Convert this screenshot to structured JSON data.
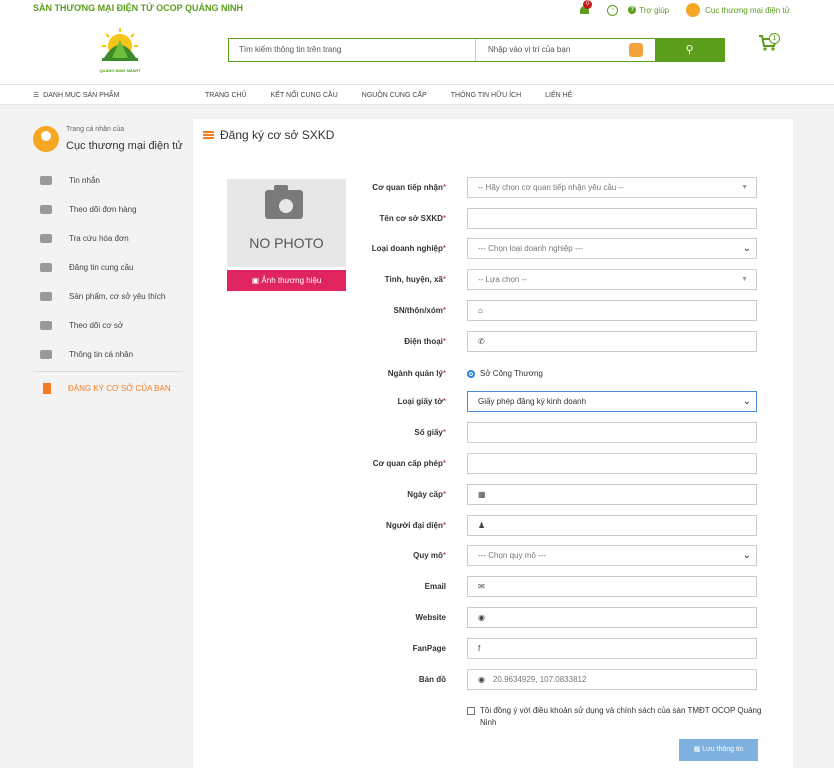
{
  "topbar": {
    "site_name": "SÀN THƯƠNG MẠI ĐIỆN TỬ OCOP QUẢNG NINH",
    "notif_count": "0",
    "help_label": "Trợ giúp",
    "user_label": "Cục thương mại điện tử"
  },
  "header": {
    "logo_text": "QUẢNG NINH SMART",
    "search_placeholder": "Tìm kiếm thông tin trên trang",
    "location_placeholder": "Nhập vào vị trí của bạn",
    "cart_count": "1"
  },
  "nav": {
    "category": "DANH MỤC SẢN PHẨM",
    "items": [
      "TRANG CHỦ",
      "KẾT NỐI CUNG CẦU",
      "NGUỒN CUNG CẤP",
      "THÔNG TIN HỮU ÍCH",
      "LIÊN HỆ"
    ]
  },
  "sidebar": {
    "profile_small": "Trang cá nhân của",
    "profile_name": "Cục thương mại điện tử",
    "items": [
      "Tin nhắn",
      "Theo dõi đơn hàng",
      "Tra cứu hóa đơn",
      "Đăng tin cung cầu",
      "Sản phẩm, cơ sở yêu thích",
      "Theo dõi cơ sở",
      "Thông tin cá nhân"
    ],
    "register": "ĐĂNG KÝ CƠ SỞ CỦA BẠN"
  },
  "main": {
    "title": "Đăng ký cơ sở SXKD",
    "no_photo": "NO PHOTO",
    "brand_button": "Ảnh thương hiệu",
    "fields": [
      {
        "label": "Cơ quan tiếp nhận",
        "required": "*",
        "value": "-- Hãy chọn cơ quan tiếp nhận yêu cầu --"
      },
      {
        "label": "Tên cơ sở SXKD",
        "required": "*",
        "value": ""
      },
      {
        "label": "Loại doanh nghiệp",
        "required": "*",
        "value": "--- Chọn loại doanh nghiệp ---"
      },
      {
        "label": "Tỉnh, huyện, xã",
        "required": "*",
        "value": "-- Lựa chọn --"
      },
      {
        "label": "SN/thôn/xóm",
        "required": "*",
        "value": ""
      },
      {
        "label": "Điện thoại",
        "required": "*",
        "value": ""
      },
      {
        "label": "Ngành quản lý",
        "required": "*",
        "value": "Sở Công Thương"
      },
      {
        "label": "Loại giấy tờ",
        "required": "*",
        "value": "Giấy phép đăng ký kinh doanh"
      },
      {
        "label": "Số giấy",
        "required": "*",
        "value": ""
      },
      {
        "label": "Cơ quan cấp phép",
        "required": "*",
        "value": ""
      },
      {
        "label": "Ngày cấp",
        "required": "*",
        "value": ""
      },
      {
        "label": "Người đại diện",
        "required": "*",
        "value": ""
      },
      {
        "label": "Quy mô",
        "required": "*",
        "value": "--- Chọn quy mô ---"
      },
      {
        "label": "Email",
        "required": "",
        "value": ""
      },
      {
        "label": "Website",
        "required": "",
        "value": ""
      },
      {
        "label": "FanPage",
        "required": "",
        "value": ""
      },
      {
        "label": "Bản đồ",
        "required": "",
        "value": "20.9634929, 107.0833812"
      }
    ],
    "agree_text": "Tôi đồng ý với điều khoản sử dụng và chính sách của sàn TMĐT OCOP Quảng Ninh",
    "save_button": "Lưu thông tin"
  },
  "colors": {
    "brand_green": "#5a9e1c",
    "accent_orange": "#f47b20",
    "pink_button": "#e0245e",
    "save_blue": "#7fb1e0"
  }
}
